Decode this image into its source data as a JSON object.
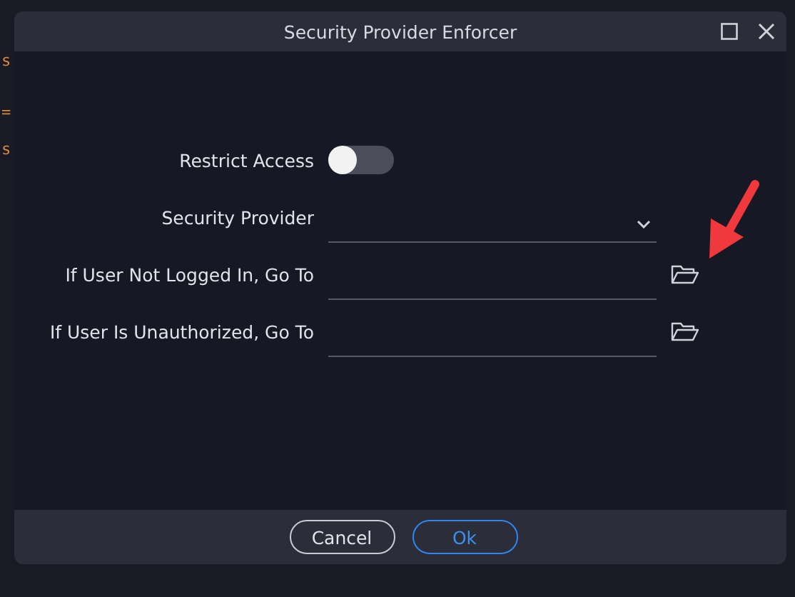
{
  "background_code": [
    "s",
    "=",
    "s"
  ],
  "window": {
    "title": "Security Provider Enforcer"
  },
  "form": [
    {
      "kind": "toggle",
      "label": "Restrict Access",
      "on": false
    },
    {
      "kind": "dropdown",
      "label": "Security Provider"
    },
    {
      "kind": "path",
      "label": "If User Not Logged In, Go To"
    },
    {
      "kind": "path",
      "label": "If User Is Unauthorized, Go To"
    }
  ],
  "buttons": [
    {
      "label": "Cancel",
      "kind": "secondary"
    },
    {
      "label": "Ok",
      "kind": "primary"
    }
  ]
}
